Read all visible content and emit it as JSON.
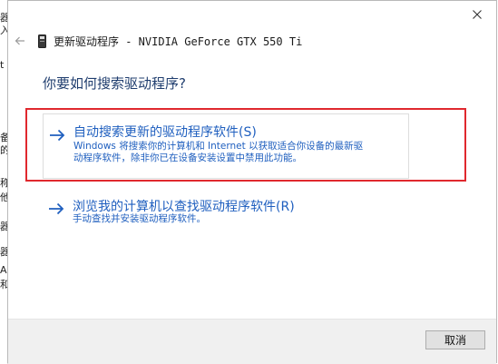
{
  "background_window": {
    "chars": [
      "器",
      "入",
      "t",
      "备",
      "的",
      "称",
      "他",
      "器",
      "器",
      "A",
      "和"
    ]
  },
  "dialog": {
    "title": "更新驱动程序 - NVIDIA GeForce GTX 550 Ti",
    "question": "你要如何搜索驱动程序?",
    "options": [
      {
        "title": "自动搜索更新的驱动程序软件(S)",
        "desc_line1": "Windows 将搜索你的计算机和 Internet 以获取适合你设备的最新驱",
        "desc_line2": "动程序软件，除非你已在设备安装设置中禁用此功能。"
      },
      {
        "title": "浏览我的计算机以查找驱动程序软件(R)",
        "desc_line1": "手动查找并安装驱动程序软件。"
      }
    ],
    "cancel_label": "取消"
  },
  "icons": {
    "close": "close-icon",
    "back": "back-arrow-icon",
    "device": "device-icon",
    "option_arrow": "right-arrow-icon"
  },
  "colors": {
    "link": "#1f5fbf",
    "highlight": "#e0282e",
    "footer_bg": "#f0f0f0"
  }
}
